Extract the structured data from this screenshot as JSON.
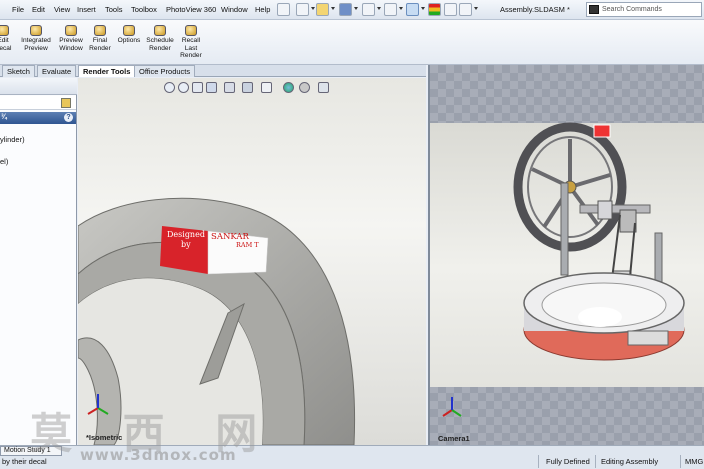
{
  "menubar": {
    "items": [
      "File",
      "Edit",
      "View",
      "Insert",
      "Tools",
      "Toolbox",
      "PhotoView 360",
      "Window",
      "Help"
    ],
    "doc_title": "Assembly.SLDASM *",
    "search_placeholder": "Search Commands"
  },
  "toolbar": {
    "buttons": [
      {
        "label": "Edit Decal",
        "icon": "edit-decal-icon"
      },
      {
        "label": "Integrated Preview",
        "icon": "integrated-preview-icon"
      },
      {
        "label": "Preview Window",
        "icon": "preview-window-icon"
      },
      {
        "label": "Final Render",
        "icon": "final-render-icon"
      },
      {
        "label": "Options",
        "icon": "options-icon"
      },
      {
        "label": "Schedule Render",
        "icon": "schedule-render-icon"
      },
      {
        "label": "Recall Last Render",
        "icon": "recall-last-render-icon"
      }
    ]
  },
  "tabs": [
    "Sketch",
    "Evaluate",
    "Render Tools",
    "Office Products"
  ],
  "active_tab": "Render Tools",
  "left_panel": {
    "items": [
      "ylinder)",
      "el)"
    ]
  },
  "viewport": {
    "decal_line1": "Designed",
    "decal_line2": "by",
    "decal_name": "SANKAR",
    "decal_name2": "RAM T",
    "view_label": "*Isometric"
  },
  "preview": {
    "camera_label": "Camera1"
  },
  "motion_tab": "Motion Study 1",
  "status": {
    "left": "by their decal",
    "state": "Fully Defined",
    "mode": "Editing Assembly",
    "units": "MMG"
  },
  "watermark": {
    "cjk": "莫 西 网",
    "url": "www.3dmox.com"
  },
  "colors": {
    "decal_red": "#d8232a",
    "tab_active": "#ffffff",
    "group_header": "#2f5591"
  }
}
